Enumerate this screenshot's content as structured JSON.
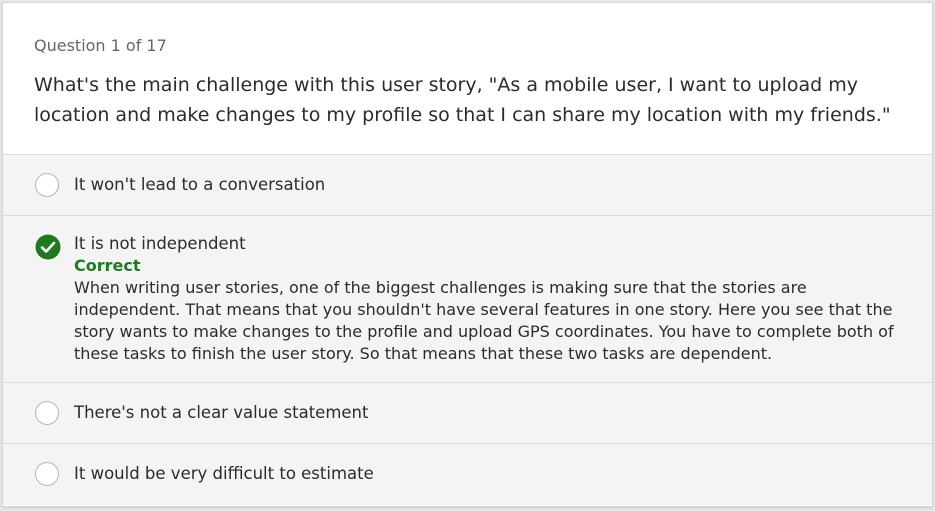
{
  "question": {
    "counter": "Question 1 of 17",
    "prompt": "What's the main challenge with this user story, \"As a mobile user, I want to upload my location and make changes to my profile so that I can share my location with my friends.\""
  },
  "options": [
    {
      "label": "It won't lead to a conversation",
      "state": "unselected"
    },
    {
      "label": "It is not independent",
      "state": "correct",
      "feedback_label": "Correct",
      "explanation": "When writing user stories, one of the biggest challenges is making sure that the stories are independent. That means that you shouldn't have several features in one story. Here you see that the story wants to make changes to the profile and upload GPS coordinates. You have to complete both of these tasks to finish the user story. So that means that these two tasks are dependent."
    },
    {
      "label": "There's not a clear value statement",
      "state": "unselected"
    },
    {
      "label": "It would be very difficult to estimate",
      "state": "unselected"
    }
  ],
  "colors": {
    "correct_green": "#1f7a1f",
    "option_background": "#f4f4f4"
  },
  "icons": {
    "unselected": "radio-circle-icon",
    "correct": "checkmark-circle-icon"
  }
}
